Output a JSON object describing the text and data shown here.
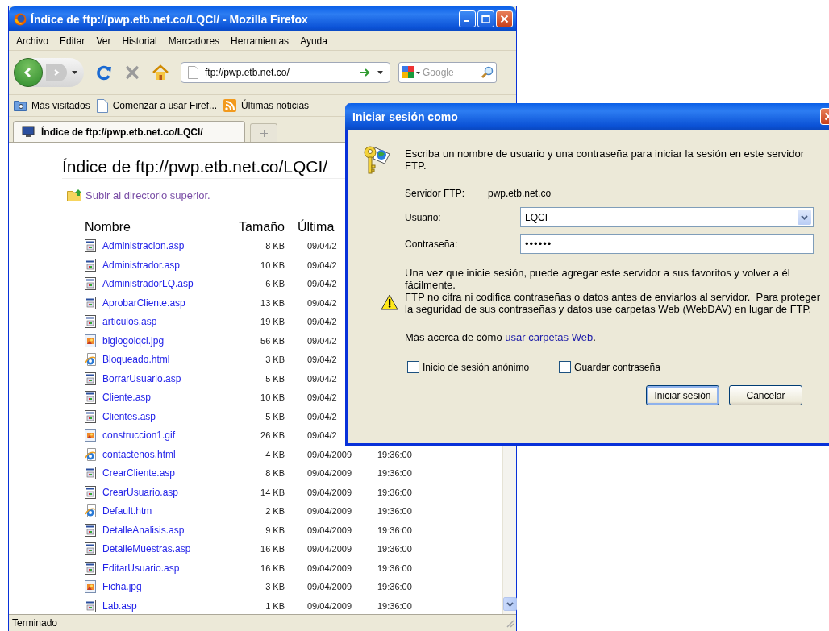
{
  "window": {
    "title": "Índice de ftp://pwp.etb.net.co/LQCI/ - Mozilla Firefox"
  },
  "menu": [
    "Archivo",
    "Editar",
    "Ver",
    "Historial",
    "Marcadores",
    "Herramientas",
    "Ayuda"
  ],
  "navigation": {
    "url": "ftp://pwp.etb.net.co/",
    "search_placeholder": "Google"
  },
  "bookmarks": [
    {
      "label": "Más visitados",
      "kind": "smart"
    },
    {
      "label": "Comenzar a usar Firef...",
      "kind": "page"
    },
    {
      "label": "Últimas noticias",
      "kind": "feed"
    }
  ],
  "tabs": [
    {
      "label": "Índice de ftp://pwp.etb.net.co/LQCI/",
      "selected": true
    }
  ],
  "page": {
    "heading": "Índice de ftp://pwp.etb.net.co/LQCI/",
    "parent_link": "Subir al directorio superior.",
    "columns": [
      "Nombre",
      "Tamaño",
      "Última"
    ],
    "rows": [
      {
        "name": "Administracion.asp",
        "kind": "asp",
        "size": "8 KB",
        "date": "09/04/2"
      },
      {
        "name": "Administrador.asp",
        "kind": "asp",
        "size": "10 KB",
        "date": "09/04/2"
      },
      {
        "name": "AdministradorLQ.asp",
        "kind": "asp",
        "size": "6 KB",
        "date": "09/04/2"
      },
      {
        "name": "AprobarCliente.asp",
        "kind": "asp",
        "size": "13 KB",
        "date": "09/04/2"
      },
      {
        "name": "articulos.asp",
        "kind": "asp",
        "size": "19 KB",
        "date": "09/04/2"
      },
      {
        "name": "biglogolqci.jpg",
        "kind": "image",
        "size": "56 KB",
        "date": "09/04/2"
      },
      {
        "name": "Bloqueado.html",
        "kind": "html",
        "size": "3 KB",
        "date": "09/04/2"
      },
      {
        "name": "BorrarUsuario.asp",
        "kind": "asp",
        "size": "5 KB",
        "date": "09/04/2"
      },
      {
        "name": "Cliente.asp",
        "kind": "asp",
        "size": "10 KB",
        "date": "09/04/2"
      },
      {
        "name": "Clientes.asp",
        "kind": "asp",
        "size": "5 KB",
        "date": "09/04/2"
      },
      {
        "name": "construccion1.gif",
        "kind": "image",
        "size": "26 KB",
        "date": "09/04/2"
      },
      {
        "name": "contactenos.html",
        "kind": "html",
        "size": "4 KB",
        "date": "09/04/2009",
        "time": "19:36:00"
      },
      {
        "name": "CrearCliente.asp",
        "kind": "asp",
        "size": "8 KB",
        "date": "09/04/2009",
        "time": "19:36:00"
      },
      {
        "name": "CrearUsuario.asp",
        "kind": "asp",
        "size": "14 KB",
        "date": "09/04/2009",
        "time": "19:36:00"
      },
      {
        "name": "Default.htm",
        "kind": "html",
        "size": "2 KB",
        "date": "09/04/2009",
        "time": "19:36:00"
      },
      {
        "name": "DetalleAnalisis.asp",
        "kind": "asp",
        "size": "9 KB",
        "date": "09/04/2009",
        "time": "19:36:00"
      },
      {
        "name": "DetalleMuestras.asp",
        "kind": "asp",
        "size": "16 KB",
        "date": "09/04/2009",
        "time": "19:36:00"
      },
      {
        "name": "EditarUsuario.asp",
        "kind": "asp",
        "size": "16 KB",
        "date": "09/04/2009",
        "time": "19:36:00"
      },
      {
        "name": "Ficha.jpg",
        "kind": "image",
        "size": "3 KB",
        "date": "09/04/2009",
        "time": "19:36:00"
      },
      {
        "name": "Lab.asp",
        "kind": "asp",
        "size": "1 KB",
        "date": "09/04/2009",
        "time": "19:36:00"
      }
    ]
  },
  "status_bar": "Terminado",
  "dialog": {
    "title": "Iniciar sesión como",
    "intro": "Escriba un nombre de usuario y una contraseña para iniciar la sesión en este servidor FTP.",
    "server_label": "Servidor FTP:",
    "server_value": "pwp.etb.net.co",
    "user_label": "Usuario:",
    "user_value": "LQCI",
    "password_label": "Contraseña:",
    "password_value": "••••••",
    "note": "Una vez que inicie sesión, puede agregar este servidor a sus favoritos y volver a él fácilmente.",
    "warning": "FTP no cifra ni codifica contraseñas o datos antes de enviarlos al servidor.  Para proteger la seguridad de sus contraseñas y datos use carpetas Web (WebDAV) en lugar de FTP.",
    "more_text": "Más acerca de cómo ",
    "more_link": "usar carpetas Web",
    "more_end": ".",
    "checkboxes": [
      {
        "label": "Inicio de sesión anónimo",
        "checked": false
      },
      {
        "label": "Guardar contraseña",
        "checked": false
      }
    ],
    "buttons": [
      {
        "label": "Iniciar sesión",
        "kind": "default"
      },
      {
        "label": "Cancelar",
        "kind": "normal"
      }
    ]
  }
}
